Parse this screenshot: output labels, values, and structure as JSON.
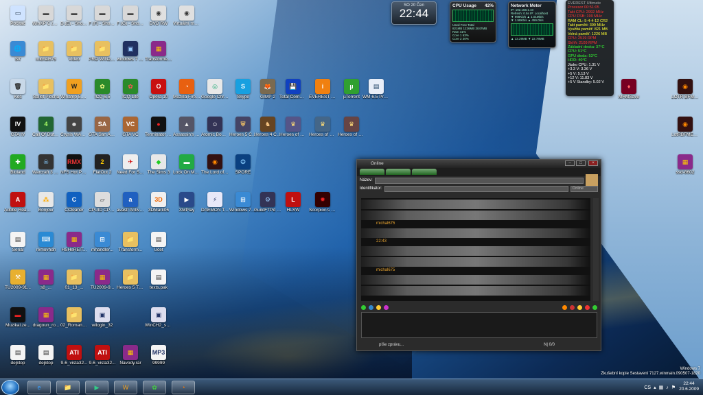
{
  "desktop_icons": [
    {
      "label": "Počítač",
      "glyph": "▭",
      "bg": "#cfe3ff",
      "fg": "#234"
    },
    {
      "label": "WinXP C (D) - Shortcut",
      "glyph": "▬",
      "bg": "#d8d8d8",
      "fg": "#444"
    },
    {
      "label": "D (E) - Shortcut",
      "glyph": "▬",
      "bg": "#d8d8d8",
      "fg": "#444"
    },
    {
      "label": "F (F) - Shortcut",
      "glyph": "▬",
      "bg": "#d8d8d8",
      "fg": "#444"
    },
    {
      "label": "F (G) - Shortcut",
      "glyph": "▬",
      "bg": "#d8d8d8",
      "fg": "#444"
    },
    {
      "label": "DVD RW",
      "glyph": "◉",
      "bg": "#e0e0e0",
      "fg": "#333"
    },
    {
      "label": "Virtuální mechanika",
      "glyph": "◉",
      "bg": "#e0e0e0",
      "fg": "#333"
    },
    {
      "label": "Síť",
      "glyph": "🌐",
      "bg": "#3a8ad4",
      "fg": "#fff"
    },
    {
      "label": "michal675",
      "glyph": "📁",
      "bg": "#e8c060",
      "fg": "#fff"
    },
    {
      "label": "Video",
      "glyph": "📁",
      "bg": "#e8c060",
      "fg": "#fff"
    },
    {
      "label": "PRO WIN25 BIRU",
      "glyph": "📁",
      "bg": "#e8c060",
      "fg": "#fff"
    },
    {
      "label": "windows 7 michal675",
      "glyph": "▣",
      "bg": "#203060",
      "fg": "#9cf"
    },
    {
      "label": "Transformers...",
      "glyph": "▦",
      "bg": "#8a2a8a",
      "fg": "#fc0"
    },
    {
      "label": "Koš",
      "glyph": "🗑",
      "bg": "#c8d8e8",
      "fg": "#333"
    },
    {
      "label": "Sdílet Plocha",
      "glyph": "📁",
      "bg": "#e8c060",
      "fg": "#fff"
    },
    {
      "label": "Winamp 5.55 Full",
      "glyph": "W",
      "bg": "#f0a020",
      "fg": "#222"
    },
    {
      "label": "ICQ 6.5",
      "glyph": "✿",
      "bg": "#2a8a2a",
      "fg": "#ff8"
    },
    {
      "label": "ICQ Lite",
      "glyph": "✿",
      "bg": "#2a8a2a",
      "fg": "#f55"
    },
    {
      "label": "Opera 10",
      "glyph": "O",
      "bg": "#c81010",
      "fg": "#fff"
    },
    {
      "label": "Mozilla Firefox 3",
      "glyph": "◔",
      "bg": "#e86010",
      "fg": "#fff"
    },
    {
      "label": "Google Chrome",
      "glyph": "◎",
      "bg": "#e8e8e8",
      "fg": "#2a7"
    },
    {
      "label": "Skype",
      "glyph": "S",
      "bg": "#18a0e0",
      "fg": "#fff"
    },
    {
      "label": "GIMP 2",
      "glyph": "🦊",
      "bg": "#7a6a50",
      "fg": "#fff"
    },
    {
      "label": "Total Commander",
      "glyph": "💾",
      "bg": "#1040c0",
      "fg": "#fff"
    },
    {
      "label": "EVEREST Ultimate",
      "glyph": "i",
      "bg": "#f08010",
      "fg": "#fff"
    },
    {
      "label": "µTorrent",
      "glyph": "µ",
      "bg": "#30a030",
      "fg": "#fff"
    },
    {
      "label": "WM 6.5 Professional",
      "glyph": "▤",
      "bg": "#e8eef8",
      "fg": "#246"
    },
    {
      "label": "GTA IV",
      "glyph": "IV",
      "bg": "#111",
      "fg": "#fff"
    },
    {
      "label": "Call Of Duty 4",
      "glyph": "4",
      "bg": "#263",
      "fg": "#af6"
    },
    {
      "label": "Crysis WARHEAD",
      "glyph": "☻",
      "bg": "#444",
      "fg": "#ddd"
    },
    {
      "label": "GTA San Andreas",
      "glyph": "SA",
      "bg": "#964",
      "fg": "#fff"
    },
    {
      "label": "GTA VC",
      "glyph": "VC",
      "bg": "#a63",
      "fg": "#fff"
    },
    {
      "label": "Terminator Salvation",
      "glyph": "●",
      "bg": "#111",
      "fg": "#e22"
    },
    {
      "label": "Assassin's Creed 2009",
      "glyph": "▲",
      "bg": "#556",
      "fg": "#eee"
    },
    {
      "label": "Atomic Bomberman",
      "glyph": "☺",
      "bg": "#335",
      "fg": "#fff"
    },
    {
      "label": "Heroes 5 Complete",
      "glyph": "⛨",
      "bg": "#446",
      "fg": "#fc6"
    },
    {
      "label": "Heroes 4 Complete",
      "glyph": "♞",
      "bg": "#642",
      "fg": "#fc8"
    },
    {
      "label": "Heroes of Might a...",
      "glyph": "♛",
      "bg": "#558",
      "fg": "#fd7"
    },
    {
      "label": "Heroes of Might & ...",
      "glyph": "♛",
      "bg": "#468",
      "fg": "#fd7"
    },
    {
      "label": "Heroes of Might and...",
      "glyph": "♛",
      "bg": "#644",
      "fg": "#fd7"
    },
    {
      "label": "Bluland",
      "glyph": "✚",
      "bg": "#2a2",
      "fg": "#fff"
    },
    {
      "label": "Warcraft 3 Ledový trůn",
      "glyph": "☠",
      "bg": "#333",
      "fg": "#8cf"
    },
    {
      "label": "NFS Hot Pursuit",
      "glyph": "RMX",
      "bg": "#111",
      "fg": "#e33"
    },
    {
      "label": "FlatOut 2",
      "glyph": "2",
      "bg": "#222",
      "fg": "#fc0"
    },
    {
      "label": "Need For Speed Undercover",
      "glyph": "✈",
      "bg": "#eee",
      "fg": "#c00"
    },
    {
      "label": "The Sims 3",
      "glyph": "◆",
      "bg": "#e8e8e8",
      "fg": "#2c2"
    },
    {
      "label": "Lock On Modern Air...",
      "glyph": "▬",
      "bg": "#2a4",
      "fg": "#fff"
    },
    {
      "label": "The Lord of the Rings...",
      "glyph": "◉",
      "bg": "#311",
      "fg": "#f80"
    },
    {
      "label": "SPORE",
      "glyph": "❂",
      "bg": "#0a4080",
      "fg": "#8cf"
    },
    {
      "label": "Adobe Reader 9",
      "glyph": "A",
      "bg": "#c01010",
      "fg": "#fff"
    },
    {
      "label": "Bonjour",
      "glyph": "⁂",
      "bg": "#e8e8e8",
      "fg": "#fa0"
    },
    {
      "label": "CCleaner",
      "glyph": "C",
      "bg": "#1060c0",
      "fg": "#fff"
    },
    {
      "label": "CPUID CPU-Z",
      "glyph": "▱",
      "bg": "#ddd",
      "fg": "#444"
    },
    {
      "label": "avast! Antivirus",
      "glyph": "a",
      "bg": "#2060c0",
      "fg": "#fff"
    },
    {
      "label": "3DMark06",
      "glyph": "3D",
      "bg": "#f0f0f0",
      "fg": "#e60"
    },
    {
      "label": "XMPlay",
      "glyph": "▶",
      "bg": "#2a4a8a",
      "fg": "#fff"
    },
    {
      "label": "DAEMON Tools Lite",
      "glyph": "⚡",
      "bg": "#e8e8f8",
      "fg": "#236"
    },
    {
      "label": "Windows 7 Upgrade Ad...",
      "glyph": "⊞",
      "bg": "#3a8ad4",
      "fg": "#fff"
    },
    {
      "label": "GuildFTPd FTP Daemon",
      "glyph": "⚙",
      "bg": "#335",
      "fg": "#9cf"
    },
    {
      "label": "HLSW",
      "glyph": "L",
      "bg": "#c01010",
      "fg": "#fff"
    },
    {
      "label": "Scorpion's WinChester 2",
      "glyph": "✹",
      "bg": "#300",
      "fg": "#e22"
    },
    {
      "label": "Seriál",
      "glyph": "▤",
      "bg": "#f4f4f4",
      "fg": "#333"
    },
    {
      "label": "removhdn",
      "glyph": "⌨",
      "bg": "#2a8ad4",
      "fg": "#fff"
    },
    {
      "label": "HSHeREIT...",
      "glyph": "▦",
      "bg": "#8a2a8a",
      "fg": "#fc0"
    },
    {
      "label": "mhandler...",
      "glyph": "⊞",
      "bg": "#3a8ad4",
      "fg": "#fff"
    },
    {
      "label": "Transform...",
      "glyph": "📁",
      "bg": "#e8c060",
      "fg": "#fff"
    },
    {
      "label": "Účet",
      "glyph": "▤",
      "bg": "#f4f4f4",
      "fg": "#333"
    },
    {
      "label": "TU2009-91...",
      "glyph": "⚒",
      "bg": "#e8b030",
      "fg": "#fff"
    },
    {
      "label": "s8_...",
      "glyph": "▦",
      "bg": "#8a2a8a",
      "fg": "#fc0"
    },
    {
      "label": "01_13_...",
      "glyph": "📁",
      "bg": "#e8c060",
      "fg": "#fff"
    },
    {
      "label": "TU2009-9...",
      "glyph": "▦",
      "bg": "#8a2a8a",
      "fg": "#fc0"
    },
    {
      "label": "Heroes 5 TOTE",
      "glyph": "📁",
      "bg": "#e8c060",
      "fg": "#fff"
    },
    {
      "label": "texts.pak",
      "glyph": "▤",
      "bg": "#f4f4f4",
      "fg": "#333"
    },
    {
      "label": "Muzikal.ze...",
      "glyph": "▬",
      "bg": "#111",
      "fg": "#e22"
    },
    {
      "label": "dragoun_ro...",
      "glyph": "▦",
      "bg": "#8a2a8a",
      "fg": "#fc0"
    },
    {
      "label": "02_Roman_...",
      "glyph": "📁",
      "bg": "#e8c060",
      "fg": "#fff"
    },
    {
      "label": "wilogin_32",
      "glyph": "▣",
      "bg": "#dde",
      "fg": "#236"
    },
    {
      "label": "WinCH2_se...",
      "glyph": "▣",
      "bg": "#dde",
      "fg": "#236"
    },
    {
      "label": "dejktop",
      "glyph": "▤",
      "bg": "#f4f4f4",
      "fg": "#333"
    },
    {
      "label": "dejktop",
      "glyph": "▤",
      "bg": "#f4f4f4",
      "fg": "#333"
    },
    {
      "label": "9-6_vista32...",
      "glyph": "ATI",
      "bg": "#c01010",
      "fg": "#fff"
    },
    {
      "label": "9-6_vista32...",
      "glyph": "ATI",
      "bg": "#c01010",
      "fg": "#fff"
    },
    {
      "label": "Navody.rar",
      "glyph": "▦",
      "bg": "#8a2a8a",
      "fg": "#fc0"
    },
    {
      "label": "99999",
      "glyph": "MP3",
      "bg": "#f4f4f4",
      "fg": "#236"
    },
    {
      "label": "MHMSave",
      "glyph": "♦",
      "bg": "#702",
      "fg": "#f66"
    },
    {
      "label": "LOTR BFME...",
      "glyph": "◉",
      "bg": "#311",
      "fg": "#f80"
    },
    {
      "label": "LotRBFME-2...",
      "glyph": "◉",
      "bg": "#311",
      "fg": "#f80"
    },
    {
      "label": "ssd-8602",
      "glyph": "▦",
      "bg": "#8a2a8a",
      "fg": "#fc0"
    }
  ],
  "clock_gadget": {
    "date": "SO 20 Čen",
    "time": "22:44"
  },
  "cpu_gadget": {
    "title": "CPU Usage",
    "percent": "42%",
    "lines": [
      "Used Free Total",
      "821MB 1226MB 2047MB",
      "Ram 41%",
      "Core 1 63%",
      "Core 2 20%"
    ]
  },
  "net_gadget": {
    "title": "Network Meter",
    "lines": [
      "IP: 192.168.1.10",
      "Refresh: 0.5s  IP: Localhost",
      "▼ 998Kb/s  ▲ 1.01Mb/s",
      "▼ 1.58Kb/s  ▲ 459.0b/s"
    ],
    "footer": "▲ 13.29MB  ▼ 22.78MB"
  },
  "everest": {
    "title": "EVEREST Ultimate",
    "lines": [
      {
        "t": "Procesor 00:51:05",
        "c": "#f33"
      },
      {
        "t": "Takt CPU: 2992 MHz",
        "c": "#f33"
      },
      {
        "t": "CPU FSB: 199 MHz",
        "c": "#f33"
      },
      {
        "t": "RAM CL: 5-4-4-12 CR2",
        "c": "#ff3"
      },
      {
        "t": "Takt paměti: 399 MHz",
        "c": "#ff3"
      },
      {
        "t": "Využitá paměť: 821 MB",
        "c": "#ff3"
      },
      {
        "t": "Volná paměť: 1226 MB",
        "c": "#ff3"
      },
      {
        "t": "CPU: 2519 RPM",
        "c": "#f33"
      },
      {
        "t": "Skříň: 2109 RPM",
        "c": "#f33"
      },
      {
        "t": "Základní deska: 37°C",
        "c": "#3f3"
      },
      {
        "t": "CPU: 51°C",
        "c": "#3f3"
      },
      {
        "t": "GPU dioda: 53°C",
        "c": "#3f3"
      },
      {
        "t": "HDD: 40°C",
        "c": "#3f3"
      },
      {
        "t": "Jádro CPU: 1.31 V",
        "c": "#fff"
      },
      {
        "t": "+3.3 V: 3.36 V",
        "c": "#fff"
      },
      {
        "t": "+5 V: 5.13 V",
        "c": "#fff"
      },
      {
        "t": "+12 V: 11.83 V",
        "c": "#fff"
      },
      {
        "t": "+5 V Standby: 5.02 V",
        "c": "#fff"
      }
    ]
  },
  "im_window": {
    "title": "Online",
    "name_label": "Název:",
    "id_label": "Identifikátor:",
    "status_select": "Online",
    "nicks": [
      "michal675",
      "22:43",
      "michal675"
    ],
    "status_text": "píše zprávu...",
    "counter": "N| 0/0"
  },
  "taskbar": {
    "start_label": "Start",
    "lang": "CS",
    "time": "22:44",
    "date": "20.6.2009",
    "buttons": [
      {
        "glyph": "e",
        "color": "#3aa0ff"
      },
      {
        "glyph": "📁",
        "color": "#f0c050"
      },
      {
        "glyph": "▶",
        "color": "#3c8"
      },
      {
        "glyph": "W",
        "color": "#f0a020"
      },
      {
        "glyph": "✿",
        "color": "#4c4"
      },
      {
        "glyph": "◔",
        "color": "#f70"
      }
    ]
  },
  "windows_version": {
    "line1": "Windows 7",
    "line2": "Zkušební kopie Sestavení 7127.winmain.090507-1820"
  }
}
